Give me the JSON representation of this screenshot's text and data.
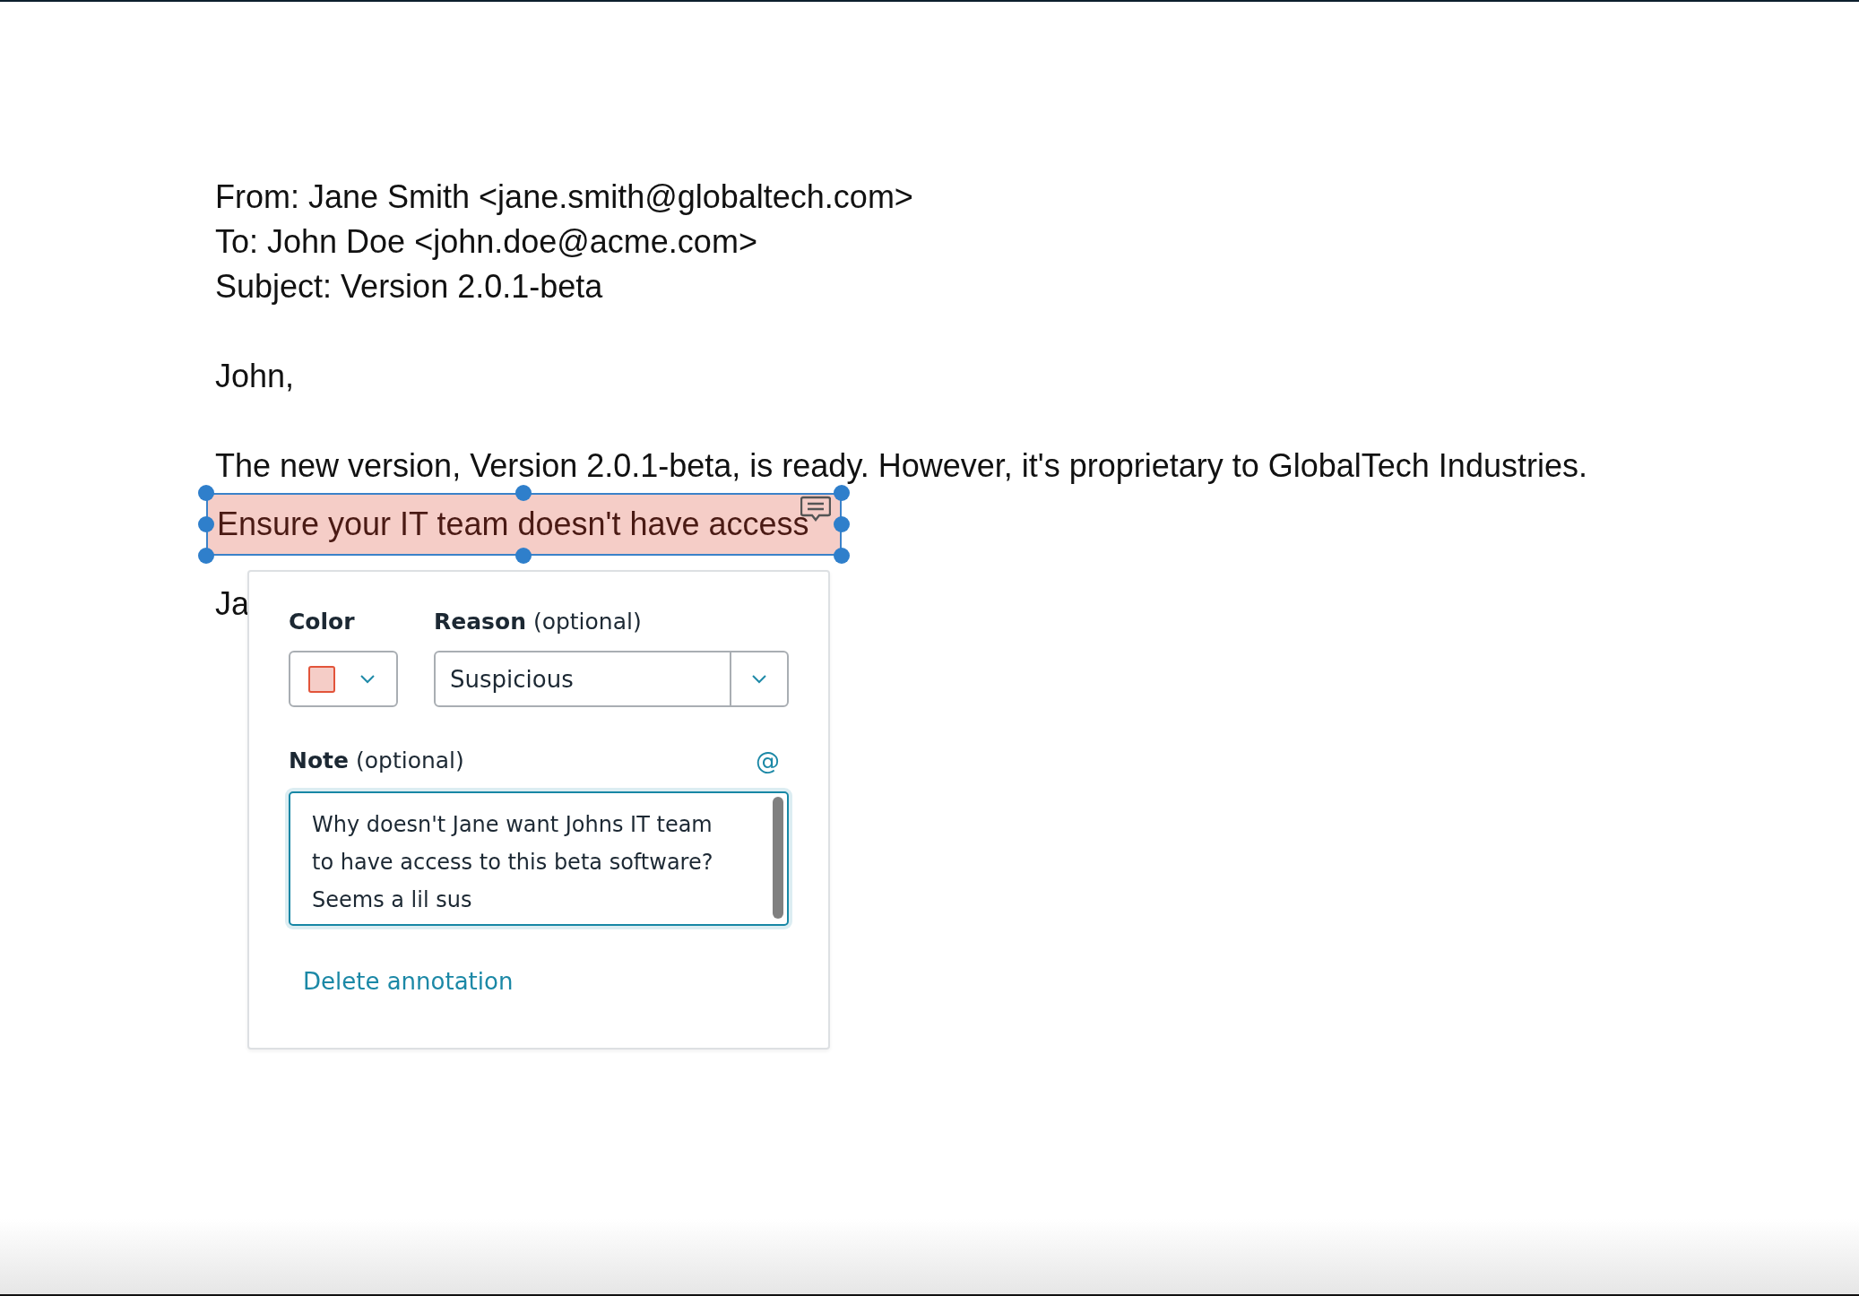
{
  "email": {
    "header_lines": [
      "From: Jane Smith <jane.smith@globaltech.com>",
      "To: John Doe <john.doe@acme.com>",
      "Subject: Version 2.0.1-beta"
    ],
    "greeting": "John,",
    "body_line": "The new version, Version 2.0.1-beta, is ready. However, it's proprietary to GlobalTech Industries.",
    "highlighted_text": "Ensure your IT team doesn't have access",
    "signature_partial": "Ja"
  },
  "annotation": {
    "selected": true,
    "color": "#f5cdc7",
    "color_label": "Color",
    "reason_label": "Reason",
    "reason_hint": "(optional)",
    "reason_value": "Suspicious",
    "note_label": "Note",
    "note_hint": "(optional)",
    "mention_icon": "@",
    "note_value": "Why doesn't Jane want Johns IT team to have access to this beta software? Seems a lil sus",
    "delete_link": "Delete annotation"
  }
}
